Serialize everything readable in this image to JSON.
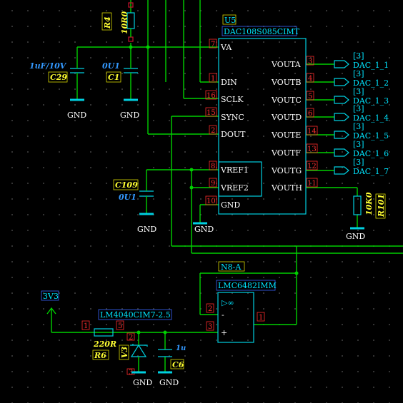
{
  "u5": {
    "ref": "U5",
    "part": "DAC108S085CIMT",
    "left_pins": [
      {
        "num": "7",
        "name": "VA"
      },
      {
        "num": "1",
        "name": "DIN"
      },
      {
        "num": "16",
        "name": "SCLK"
      },
      {
        "num": "15",
        "name": "SYNC"
      },
      {
        "num": "2",
        "name": "DOUT"
      },
      {
        "num": "8",
        "name": "VREF1"
      },
      {
        "num": "9",
        "name": "VREF2"
      },
      {
        "num": "10",
        "name": "GND"
      }
    ],
    "right_pins": [
      {
        "num": "3",
        "name": "VOUTA",
        "net": "DAC_1_1"
      },
      {
        "num": "4",
        "name": "VOUTB",
        "net": "DAC_1_2"
      },
      {
        "num": "5",
        "name": "VOUTC",
        "net": "DAC_1_3"
      },
      {
        "num": "6",
        "name": "VOUTD",
        "net": "DAC_1_4"
      },
      {
        "num": "14",
        "name": "VOUTE",
        "net": "DAC_1_5"
      },
      {
        "num": "13",
        "name": "VOUTF",
        "net": "DAC_1_6"
      },
      {
        "num": "12",
        "name": "VOUTG",
        "net": "DAC_1_7"
      },
      {
        "num": "11",
        "name": "VOUTH",
        "net": ""
      }
    ],
    "sheet_ref": "[3]"
  },
  "r4": {
    "ref": "R4",
    "value": "10R0"
  },
  "c29": {
    "ref": "C29",
    "value": "1uF/10V"
  },
  "c1": {
    "ref": "C1",
    "value": "0U1"
  },
  "c109": {
    "ref": "C109",
    "value": "0U1"
  },
  "r101": {
    "ref": "R101",
    "value": "10K0"
  },
  "r6": {
    "ref": "R6",
    "value": "220R",
    "pin_left": "1",
    "pin_right": "5"
  },
  "v3": {
    "ref": "V3",
    "part": "LM4040CIM7-2.5",
    "pin_top": "2",
    "pin_bottom": "3"
  },
  "c6": {
    "ref": "C6",
    "value": "1u"
  },
  "opamp": {
    "ref": "N8-A",
    "part": "LMC6482IMM",
    "pin_inv": "2",
    "pin_noninv": "3",
    "pin_out": "1",
    "symbol": "▷∞",
    "minus": "-",
    "plus": "+"
  },
  "power": {
    "rail": "3V3",
    "ground": "GND"
  }
}
